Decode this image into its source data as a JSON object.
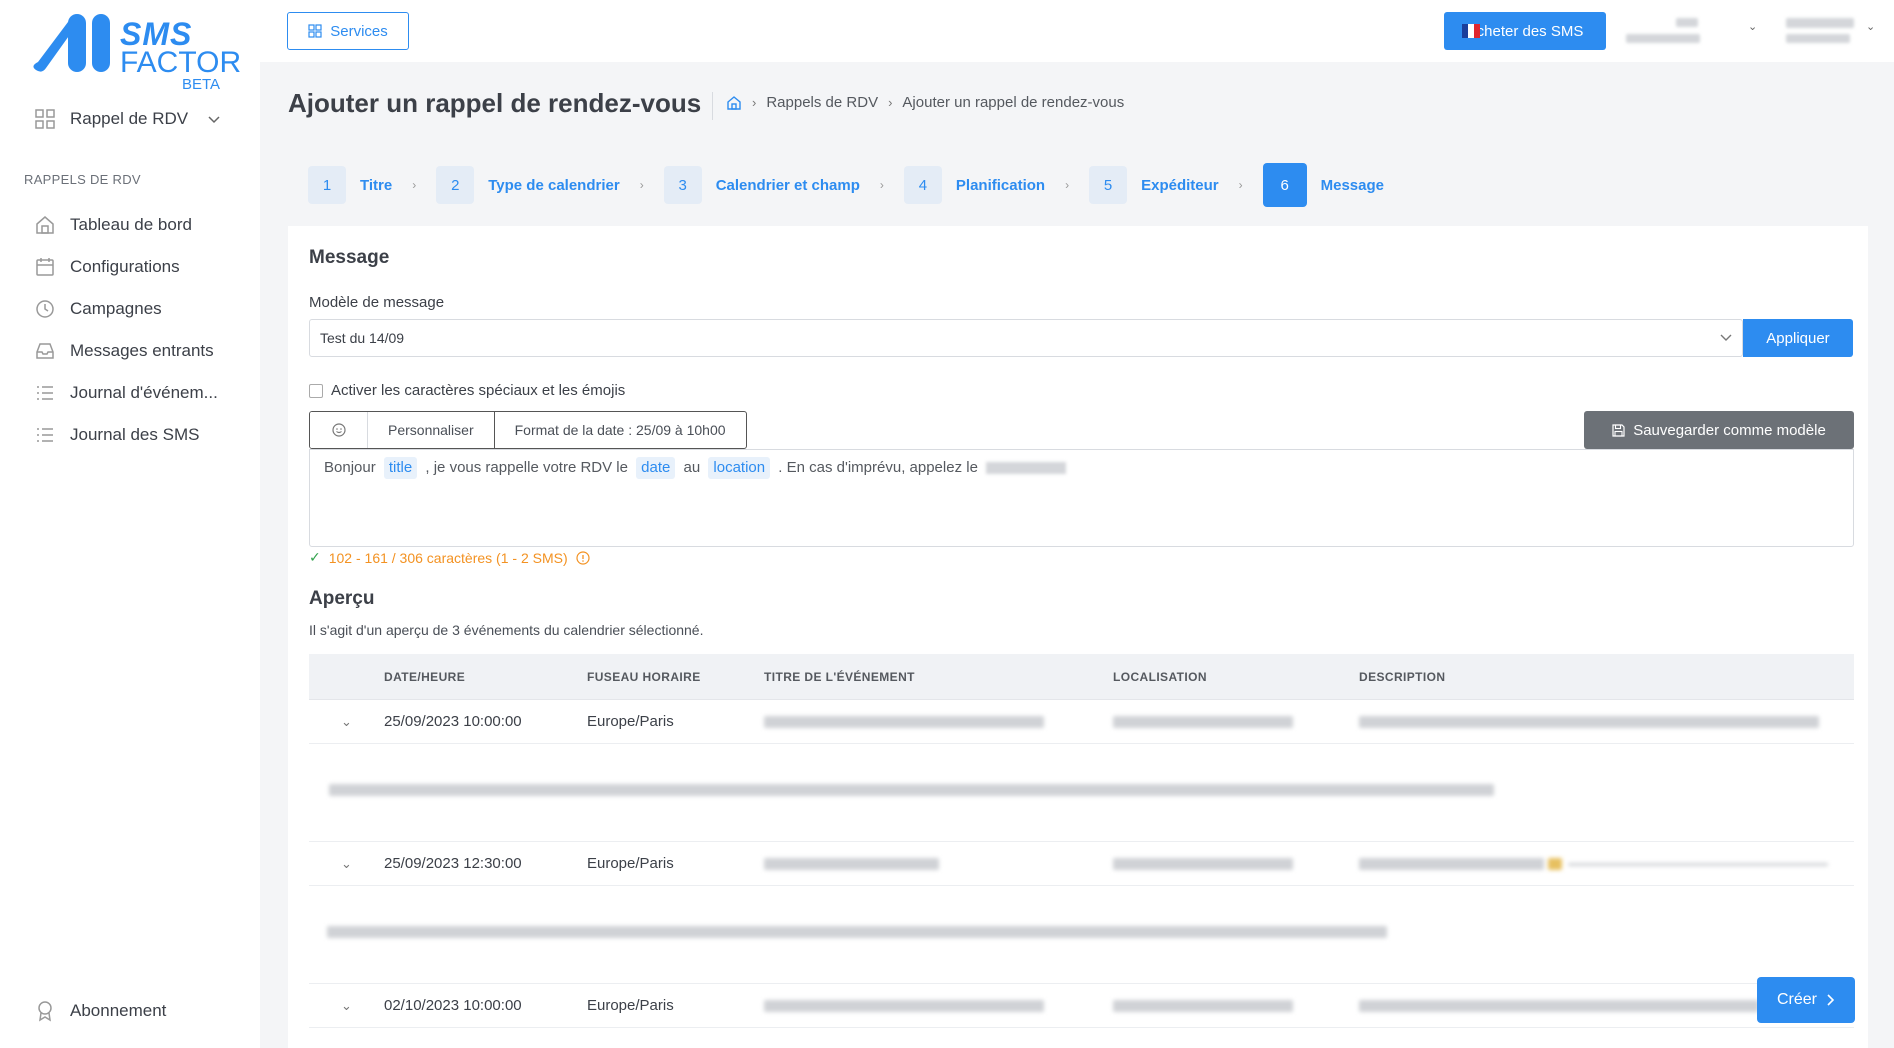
{
  "brand": {
    "line1": "SMS",
    "line2": "FACTOR",
    "line3": "BETA"
  },
  "sidebar": {
    "app_selector": "Rappel de RDV",
    "section": "RAPPELS DE RDV",
    "items": [
      {
        "label": "Tableau de bord",
        "icon": "home-icon"
      },
      {
        "label": "Configurations",
        "icon": "calendar-icon"
      },
      {
        "label": "Campagnes",
        "icon": "clock-icon"
      },
      {
        "label": "Messages entrants",
        "icon": "inbox-icon"
      },
      {
        "label": "Journal d'événem...",
        "icon": "list-icon"
      },
      {
        "label": "Journal des SMS",
        "icon": "list-icon"
      }
    ],
    "bottom": {
      "label": "Abonnement",
      "icon": "award-icon"
    }
  },
  "topbar": {
    "services": "Services",
    "buy": "Acheter des SMS"
  },
  "page": {
    "title": "Ajouter un rappel de rendez-vous",
    "breadcrumb": [
      "Rappels de RDV",
      "Ajouter un rappel de rendez-vous"
    ]
  },
  "steps": [
    {
      "num": "1",
      "label": "Titre"
    },
    {
      "num": "2",
      "label": "Type de calendrier"
    },
    {
      "num": "3",
      "label": "Calendrier et champ"
    },
    {
      "num": "4",
      "label": "Planification"
    },
    {
      "num": "5",
      "label": "Expéditeur"
    },
    {
      "num": "6",
      "label": "Message"
    }
  ],
  "message": {
    "heading": "Message",
    "template_label": "Modèle de message",
    "template_value": "Test du 14/09",
    "apply": "Appliquer",
    "special_chars": "Activer les caractères spéciaux et les émojis",
    "personalize": "Personnaliser",
    "date_format": "Format de la date : 25/09 à 10h00",
    "save_template": "Sauvegarder comme modèle",
    "body": {
      "part1": "Bonjour",
      "tag1": "title",
      "part2": ", je vous rappelle votre RDV le",
      "tag2": "date",
      "part3": "au",
      "tag3": "location",
      "part4": ". En cas d'imprévu, appelez le"
    },
    "count": "102 - 161 / 306 caractères (1 - 2 SMS)"
  },
  "preview": {
    "heading": "Aperçu",
    "desc": "Il s'agit d'un aperçu de 3 événements du calendrier sélectionné.",
    "columns": [
      "DATE/HEURE",
      "FUSEAU HORAIRE",
      "TITRE DE L'ÉVÉNEMENT",
      "LOCALISATION",
      "DESCRIPTION"
    ],
    "rows": [
      {
        "date": "25/09/2023 10:00:00",
        "tz": "Europe/Paris"
      },
      {
        "date": "25/09/2023 12:30:00",
        "tz": "Europe/Paris"
      },
      {
        "date": "02/10/2023 10:00:00",
        "tz": "Europe/Paris"
      }
    ]
  },
  "create": "Créer",
  "colors": {
    "primary": "#2d8cf0",
    "warning": "#f39222",
    "success": "#31a24c",
    "secondary": "#6c7177"
  }
}
